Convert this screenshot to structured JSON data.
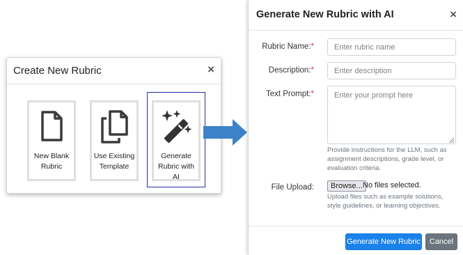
{
  "create_dialog": {
    "title": "Create New Rubric",
    "close_symbol": "×",
    "options": [
      {
        "icon": "blank-document-icon",
        "line1": "New Blank",
        "line2": "Rubric"
      },
      {
        "icon": "copy-documents-icon",
        "line1": "Use Existing",
        "line2": "Template"
      },
      {
        "icon": "magic-wand-icon",
        "line1": "Generate",
        "line2": "Rubric with AI",
        "selected": true
      }
    ]
  },
  "colors": {
    "arrow": "#3c82c8",
    "primary_button": "#1a82ea",
    "secondary_button": "#6c757d",
    "selection_outline": "#2a2aa8",
    "required_marker": "#d9302c"
  },
  "ai_dialog": {
    "title": "Generate New Rubric with AI",
    "close_symbol": "×",
    "required_marker": "*",
    "rubric_name": {
      "label": "Rubric Name:",
      "placeholder": "Enter rubric name"
    },
    "description": {
      "label": "Description:",
      "placeholder": "Enter description"
    },
    "text_prompt": {
      "label": "Text Prompt:",
      "placeholder": "Enter your prompt here",
      "help": "Provide instructions for the LLM, such as assignment descriptions, grade level, or evaluation criteria."
    },
    "file_upload": {
      "label": "File Upload:",
      "browse_label": "Browse...",
      "status": "No files selected.",
      "help": "Upload files such as example solutions, style guidelines, or learning objectives."
    },
    "submit_label": "Generate New Rubric",
    "cancel_label": "Cancel"
  }
}
